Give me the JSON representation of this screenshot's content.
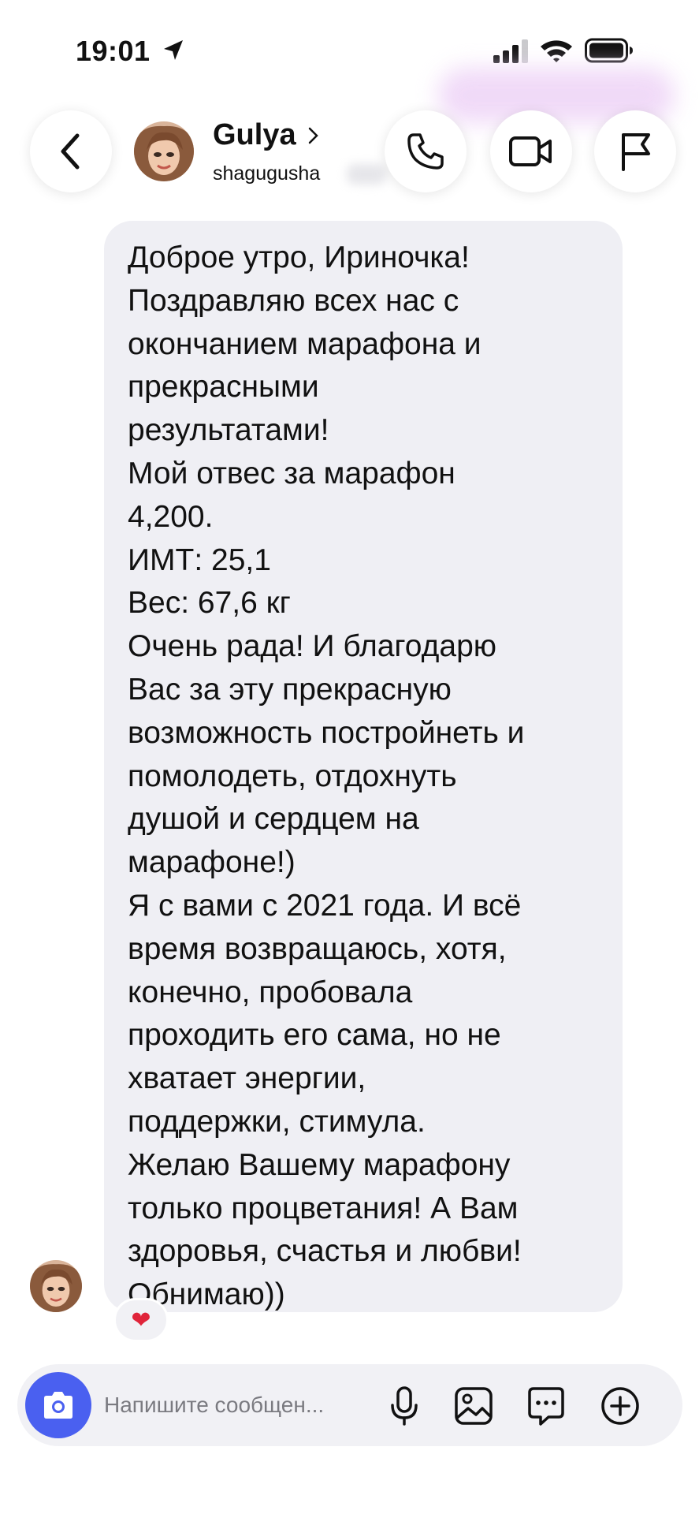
{
  "status_bar": {
    "time": "19:01"
  },
  "header": {
    "contact_name": "Gulya",
    "contact_handle": "shagugusha",
    "icons": [
      "back-icon",
      "phone-icon",
      "video-icon",
      "flag-icon"
    ]
  },
  "message": {
    "lines": [
      "Доброе утро, Ириночка!",
      "Поздравляю всех нас с",
      "окончанием марафона и",
      "прекрасными",
      "результатами!",
      "Мой отвес за марафон",
      "4,200.",
      "ИМТ: 25,1",
      "Вес: 67,6 кг",
      "Очень рада! И благодарю",
      "Вас за эту прекрасную",
      "возможность постройнеть и",
      "помолодеть, отдохнуть",
      "душой и сердцем на",
      "марафоне!)",
      "Я с вами с 2021 года. И всё",
      "время возвращаюсь, хотя,",
      "конечно, пробовала",
      "проходить его сама, но не",
      "хватает энергии,",
      "поддержки, стимула.",
      "Желаю Вашему марафону",
      "только процветания! А Вам",
      "здоровья, счастья и любви!",
      "Обнимаю))"
    ],
    "reaction": "❤"
  },
  "composer": {
    "placeholder": "Напишите сообщен...",
    "icons": [
      "camera-icon",
      "microphone-icon",
      "gallery-icon",
      "sticker-icon",
      "plus-icon"
    ]
  },
  "colors": {
    "bubble": "#efeff4",
    "accent": "#4a60f0",
    "reaction": "#e0243a"
  }
}
